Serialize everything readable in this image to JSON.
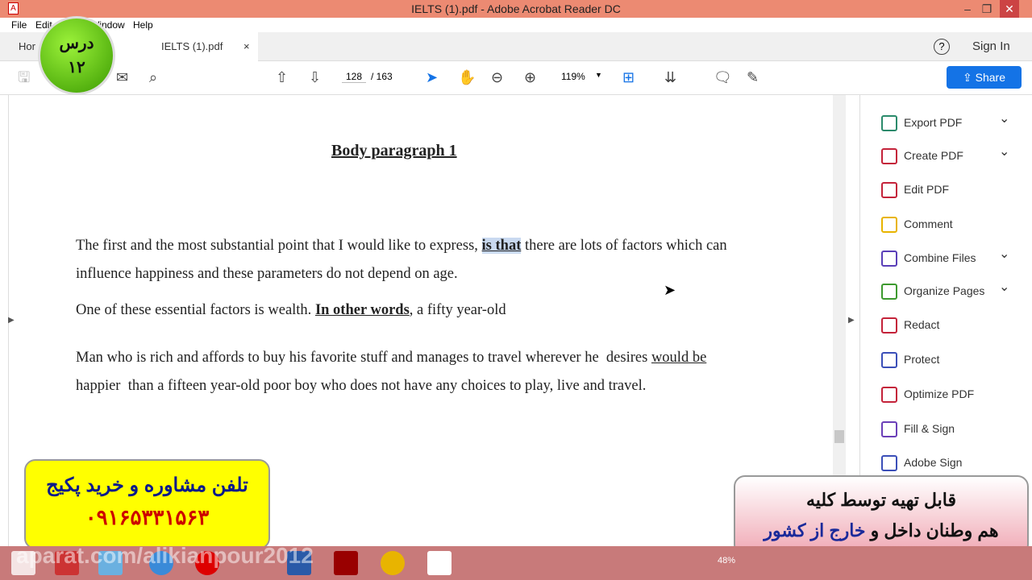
{
  "window": {
    "title": "IELTS (1).pdf - Adobe Acrobat Reader DC"
  },
  "menu": [
    "File",
    "Edit",
    "Window",
    "Help"
  ],
  "tabs": {
    "home": "Hor",
    "doc": "IELTS (1).pdf",
    "close": "×"
  },
  "header": {
    "help": "?",
    "sign_in": "Sign In",
    "share": "Share"
  },
  "toolbar": {
    "page_current": "128",
    "page_sep": "/ 163",
    "zoom": "119%"
  },
  "document": {
    "heading": "Body paragraph 1",
    "p1a": "The first and the most substantial point that I would like to express, ",
    "p1b": "is that",
    "p1c": " there are lots of factors which can influence happiness and these parameters do not depend on age.",
    "p2a": "One of these essential factors is wealth. ",
    "p2b": "In other words",
    "p2c": ", a fifty year-old",
    "p3a": "Man who is rich and affords to buy his favorite stuff and manages to travel wherever he  desires ",
    "p3b": "would be",
    "p3c": "   happier  than a fifteen year-old poor boy who does not have any choices to play, live and travel."
  },
  "right_panel": [
    {
      "label": "Export PDF",
      "color": "#2b8a6b",
      "chevron": true
    },
    {
      "label": "Create PDF",
      "color": "#c4233a",
      "chevron": true
    },
    {
      "label": "Edit PDF",
      "color": "#c4233a",
      "chevron": false
    },
    {
      "label": "Comment",
      "color": "#e8b400",
      "chevron": false
    },
    {
      "label": "Combine Files",
      "color": "#5a3fb8",
      "chevron": true
    },
    {
      "label": "Organize Pages",
      "color": "#3d9a2f",
      "chevron": true
    },
    {
      "label": "Redact",
      "color": "#c4233a",
      "chevron": false
    },
    {
      "label": "Protect",
      "color": "#3b4fb8",
      "chevron": false
    },
    {
      "label": "Optimize PDF",
      "color": "#c4233a",
      "chevron": false
    },
    {
      "label": "Fill & Sign",
      "color": "#6b3fb8",
      "chevron": false
    },
    {
      "label": "Adobe Sign",
      "color": "#3b4fb8",
      "chevron": false
    }
  ],
  "overlays": {
    "badge_line1": "درس",
    "badge_line2": "۱۲",
    "promo1_line1": "تلفن مشاوره و خرید پکیج",
    "promo1_line2": "۰۹۱۶۵۳۳۱۵۶۳",
    "promo2_line1": "قابل تهیه توسط کلیه",
    "promo2_line2a": "هم وطنان داخل و ",
    "promo2_line2b": "خارج از کشور",
    "watermark": "aparat.com/alikianpour2012"
  },
  "taskbar": {
    "battery": "48%"
  }
}
